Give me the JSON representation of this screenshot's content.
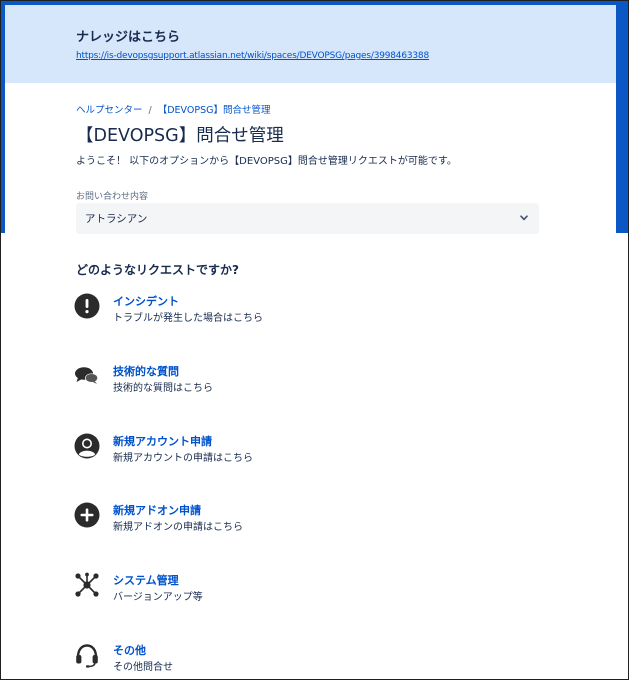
{
  "banner": {
    "title": "ナレッジはこちら",
    "link": "https://is-devopsgsupport.atlassian.net/wiki/spaces/DEVOPSG/pages/3998463388"
  },
  "breadcrumb": {
    "home": "ヘルプセンター",
    "separator": "/",
    "current": "【DEVOPSG】問合せ管理"
  },
  "page": {
    "title": "【DEVOPSG】問合せ管理",
    "description": "ようこそ！ 以下のオプションから【DEVOPSG】問合せ管理リクエストが可能です。"
  },
  "contact_field": {
    "label": "お問い合わせ内容",
    "value": "アトラシアン"
  },
  "request_section": {
    "question": "どのようなリクエストですか?"
  },
  "request_types": [
    {
      "name": "インシデント",
      "description": "トラブルが発生した場合はこちら",
      "icon": "exclamation-circle-icon"
    },
    {
      "name": "技術的な質問",
      "description": "技術的な質問はこちら",
      "icon": "chat-bubbles-icon"
    },
    {
      "name": "新規アカウント申請",
      "description": "新規アカウントの申請はこちら",
      "icon": "user-avatar-icon"
    },
    {
      "name": "新規アドオン申請",
      "description": "新規アドオンの申請はこちら",
      "icon": "plus-circle-icon"
    },
    {
      "name": "システム管理",
      "description": "バージョンアップ等",
      "icon": "network-nodes-icon"
    },
    {
      "name": "その他",
      "description": "その他問合せ",
      "icon": "headset-icon"
    }
  ],
  "colors": {
    "brand_blue": "#0b57c5",
    "banner_bg": "#d6e7fb",
    "link": "#0052cc",
    "text": "#172b4d"
  }
}
